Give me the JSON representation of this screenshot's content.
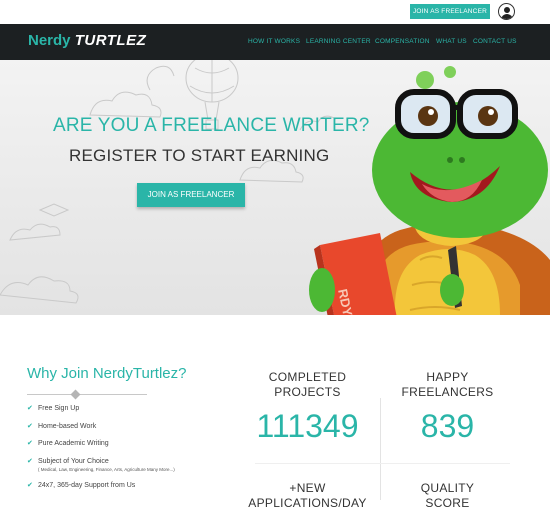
{
  "topbar": {
    "cta_label": "JOIN AS FREELANCER",
    "avatar_icon": "user-avatar-icon"
  },
  "brand": {
    "part1": "Nerdy",
    "part2": "TURTLEZ"
  },
  "nav": [
    "HOW IT WORKS",
    "LEARNING CENTER",
    "COMPENSATION",
    "WHAT US",
    "CONTACT US"
  ],
  "hero": {
    "question": "ARE YOU A FREELANCE WRITER?",
    "subtitle": "REGISTER TO START EARNING",
    "cta_label": "JOIN AS FREELANCER",
    "book_text": "RDY"
  },
  "why": {
    "title": "Why Join NerdyTurtlez?",
    "items": [
      {
        "text": "Free Sign Up"
      },
      {
        "text": "Home-based Work"
      },
      {
        "text": "Pure Academic Writing"
      },
      {
        "text": "Subject of Your Choice",
        "note": "( Medical, Law, Engineering, Finance, Arts, Agriculture Many More...)"
      },
      {
        "text": "24x7, 365-day Support from Us"
      }
    ]
  },
  "stats": [
    {
      "label_line1": "COMPLETED",
      "label_line2": "PROJECTS",
      "value": "111349"
    },
    {
      "label_line1": "HAPPY",
      "label_line2": "FREELANCERS",
      "value": "839"
    },
    {
      "label_line1": "+NEW",
      "label_line2": "APPLICATIONS/DAY"
    },
    {
      "label_line1": "QUALITY",
      "label_line2": "SCORE"
    }
  ],
  "colors": {
    "accent": "#2ab5a8",
    "navbar": "#1c2022",
    "turtle_green": "#4cb834"
  }
}
